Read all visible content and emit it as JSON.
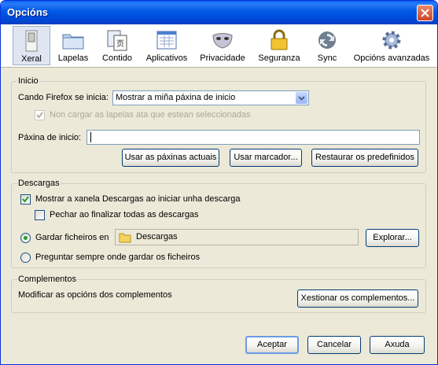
{
  "window": {
    "title": "Opcións"
  },
  "tabs": [
    {
      "label": "Xeral",
      "icon": "switch-icon",
      "selected": true
    },
    {
      "label": "Lapelas",
      "icon": "tabs-folder-icon"
    },
    {
      "label": "Contido",
      "icon": "content-page-icon"
    },
    {
      "label": "Aplicativos",
      "icon": "applications-icon"
    },
    {
      "label": "Privacidade",
      "icon": "privacy-mask-icon"
    },
    {
      "label": "Seguranza",
      "icon": "padlock-icon"
    },
    {
      "label": "Sync",
      "icon": "sync-icon"
    },
    {
      "label": "Opcións avanzadas",
      "icon": "gear-icon"
    }
  ],
  "startup": {
    "group_title": "Inicio",
    "when_label": "Cando Firefox se inicia:",
    "when_value": "Mostrar a miña páxina de inicio",
    "no_load_tabs": "Non cargar as lapelas ata que estean seleccionadas",
    "homepage_label": "Páxina de inicio:",
    "homepage_value": "",
    "btn_current": "Usar as páxinas actuais",
    "btn_bookmark": "Usar marcador...",
    "btn_restore": "Restaurar os predefinidos"
  },
  "downloads": {
    "group_title": "Descargas",
    "show_window": "Mostrar a xanela Descargas ao iniciar unha descarga",
    "close_when_done": "Pechar ao finalizar todas as descargas",
    "save_files_in": "Gardar ficheiros en",
    "folder": "Descargas",
    "btn_browse": "Explorar...",
    "always_ask": "Preguntar sempre onde gardar os ficheiros"
  },
  "addons": {
    "group_title": "Complementos",
    "description": "Modificar as opcións dos complementos",
    "btn_manage": "Xestionar os complementos..."
  },
  "footer": {
    "ok": "Aceptar",
    "cancel": "Cancelar",
    "help": "Axuda"
  }
}
